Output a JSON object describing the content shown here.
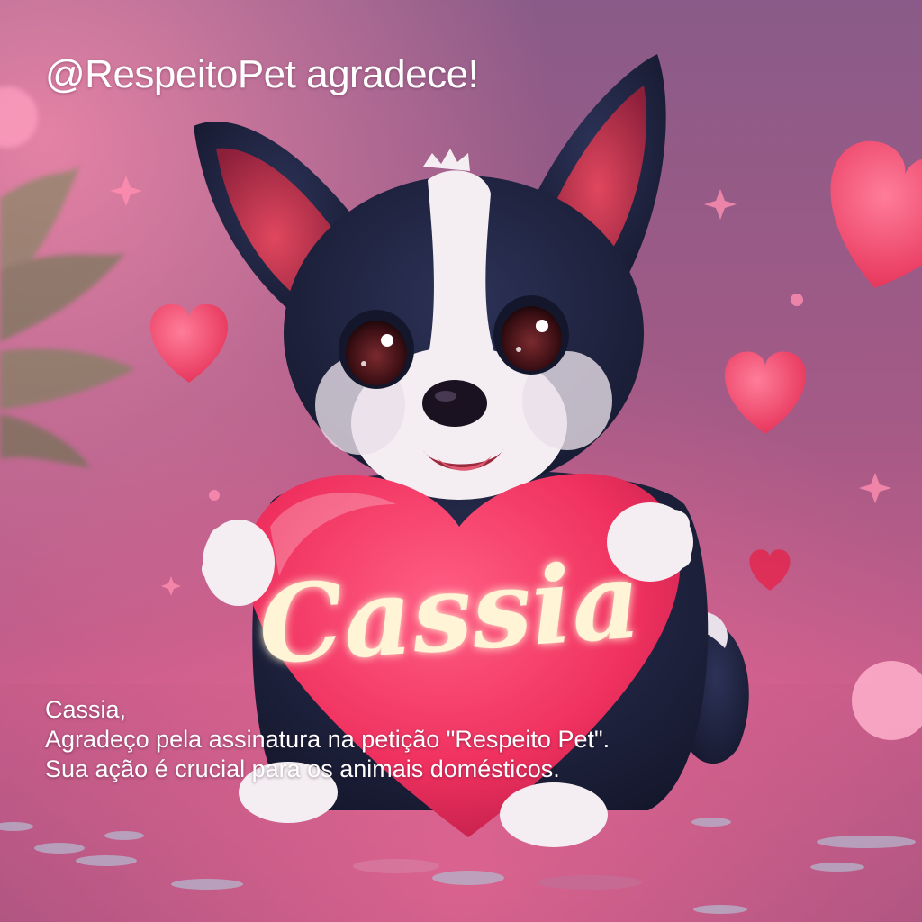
{
  "header": {
    "text": "@RespeitoPet agradece!"
  },
  "heart_sign": {
    "name": "Cassia"
  },
  "message": {
    "line1": "Cassia,",
    "line2": "Agradeço pela assinatura na petição \"Respeito Pet\".",
    "line3": "Sua ação é crucial para os animais domésticos."
  },
  "colors": {
    "background_top": "#8b5a86",
    "background_bottom": "#d96a92",
    "heart": "#f0315f",
    "heart_text": "#fff4d6",
    "dog_fur_dark": "#1f2340",
    "dog_fur_light": "#f4eef2",
    "ear_inner": "#c8344f"
  }
}
